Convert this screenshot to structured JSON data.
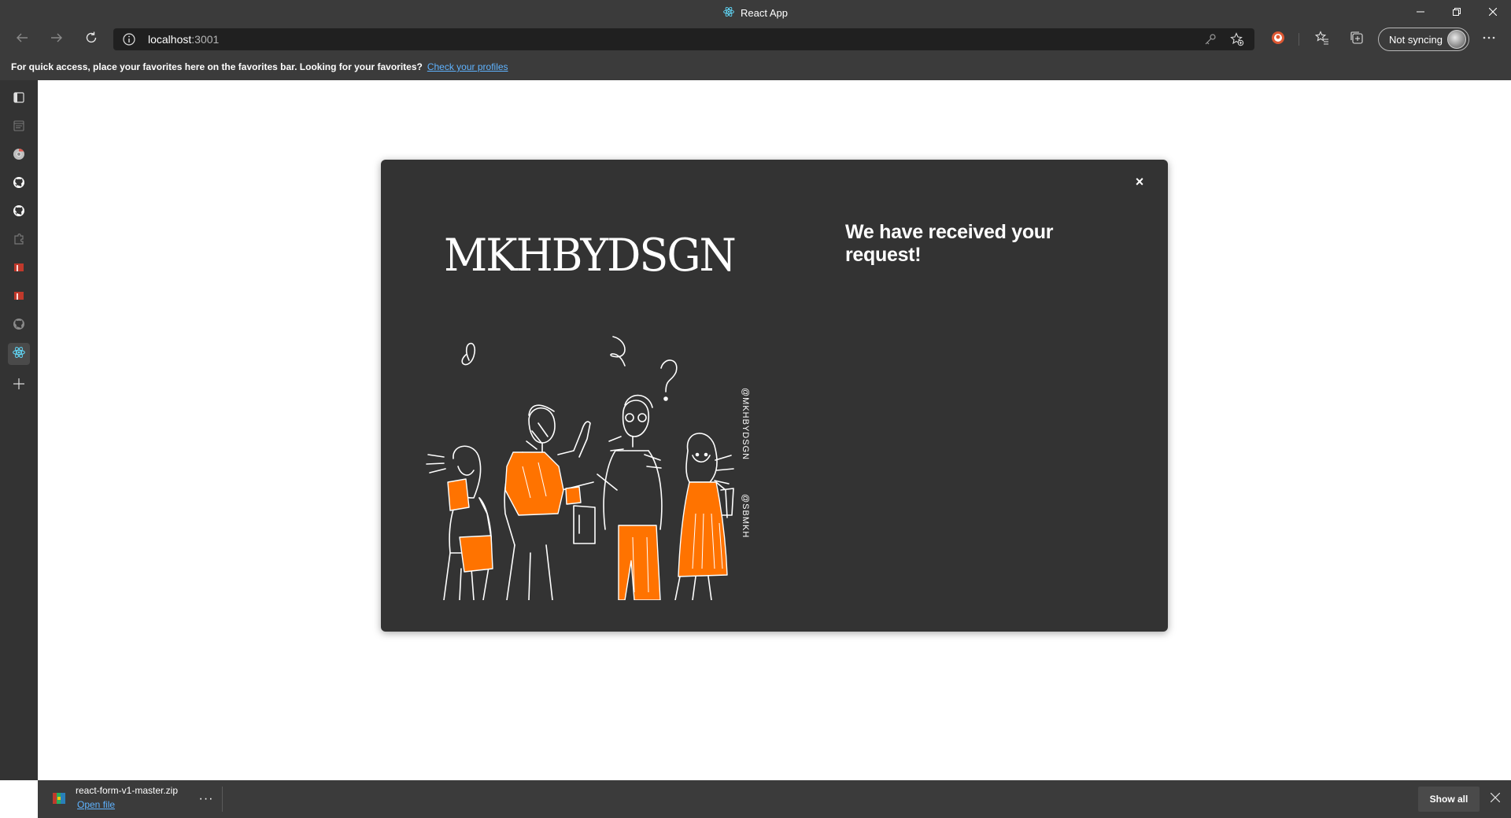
{
  "window": {
    "title": "React App",
    "minimize_icon": "minimize-icon",
    "restore_icon": "restore-icon",
    "close_icon": "close-icon"
  },
  "toolbar": {
    "address_host": "localhost",
    "address_port": ":3001",
    "sync_label": "Not syncing"
  },
  "favorites_bar": {
    "message": "For quick access, place your favorites here on the favorites bar. Looking for your favorites?",
    "link_label": "Check your profiles"
  },
  "sidebar": {
    "items": [
      "tab-actions-icon",
      "collections-icon",
      "chrome-icon",
      "github-icon",
      "github-icon",
      "extensions-icon",
      "bookmark-icon",
      "bookmark-icon",
      "github-icon",
      "react-icon",
      "add-icon"
    ]
  },
  "modal": {
    "brand": "MKHBYDSGN",
    "handle_1": "@MKHBYDSGN",
    "handle_2": "@SBMKH",
    "title": "We have received your request!",
    "close_label": "×"
  },
  "download_bar": {
    "file_name": "react-form-v1-master.zip",
    "open_label": "Open file",
    "more_label": "···",
    "show_all_label": "Show all"
  },
  "colors": {
    "chrome_dark": "#3b3b3b",
    "modal_bg": "#333333",
    "accent_orange": "#ff7300",
    "link_blue": "#5fb3ff"
  }
}
